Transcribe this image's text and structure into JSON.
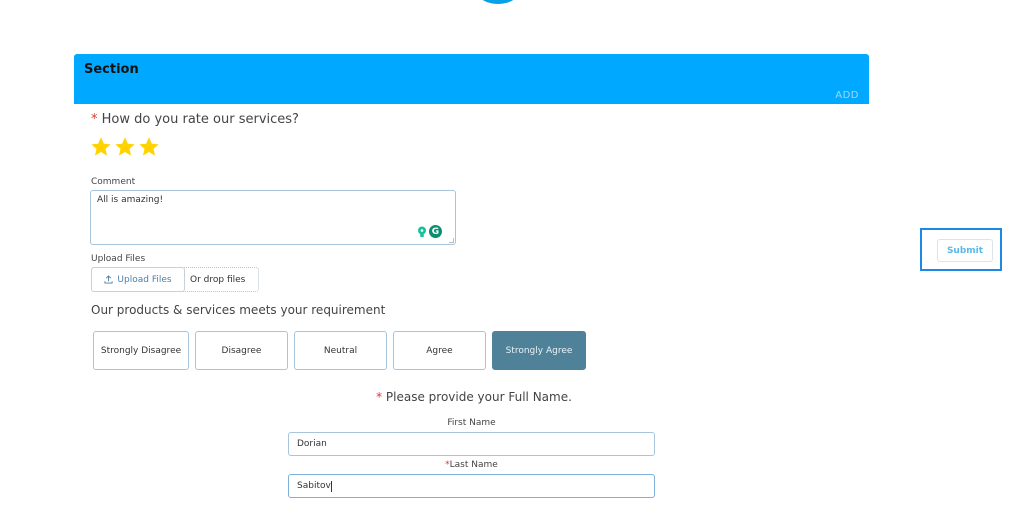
{
  "section": {
    "title": "Section",
    "add_label": "ADD"
  },
  "rating": {
    "required_mark": "*",
    "question": "How do you rate our services?",
    "value": 3,
    "star_color": "#ffd200"
  },
  "comment": {
    "label": "Comment",
    "value": "All is amazing!"
  },
  "upload": {
    "label": "Upload Files",
    "button_label": "Upload Files",
    "drop_text": "Or drop files"
  },
  "likert": {
    "question": "Our products & services meets your requirement",
    "options": [
      "Strongly Disagree",
      "Disagree",
      "Neutral",
      "Agree",
      "Strongly Agree"
    ],
    "selected": "Strongly Agree",
    "selected_color": "#4f8299"
  },
  "full_name": {
    "required_mark": "*",
    "question": "Please provide your Full Name.",
    "first_name_label": "First Name",
    "first_name_value": "Dorian",
    "last_name_required_mark": "*",
    "last_name_label": "Last Name",
    "last_name_value": "Sabitov"
  },
  "submit": {
    "label": "Submit"
  },
  "colors": {
    "header": "#00a8ff",
    "required": "#e3342f",
    "focus_outline": "#1e88e5"
  }
}
